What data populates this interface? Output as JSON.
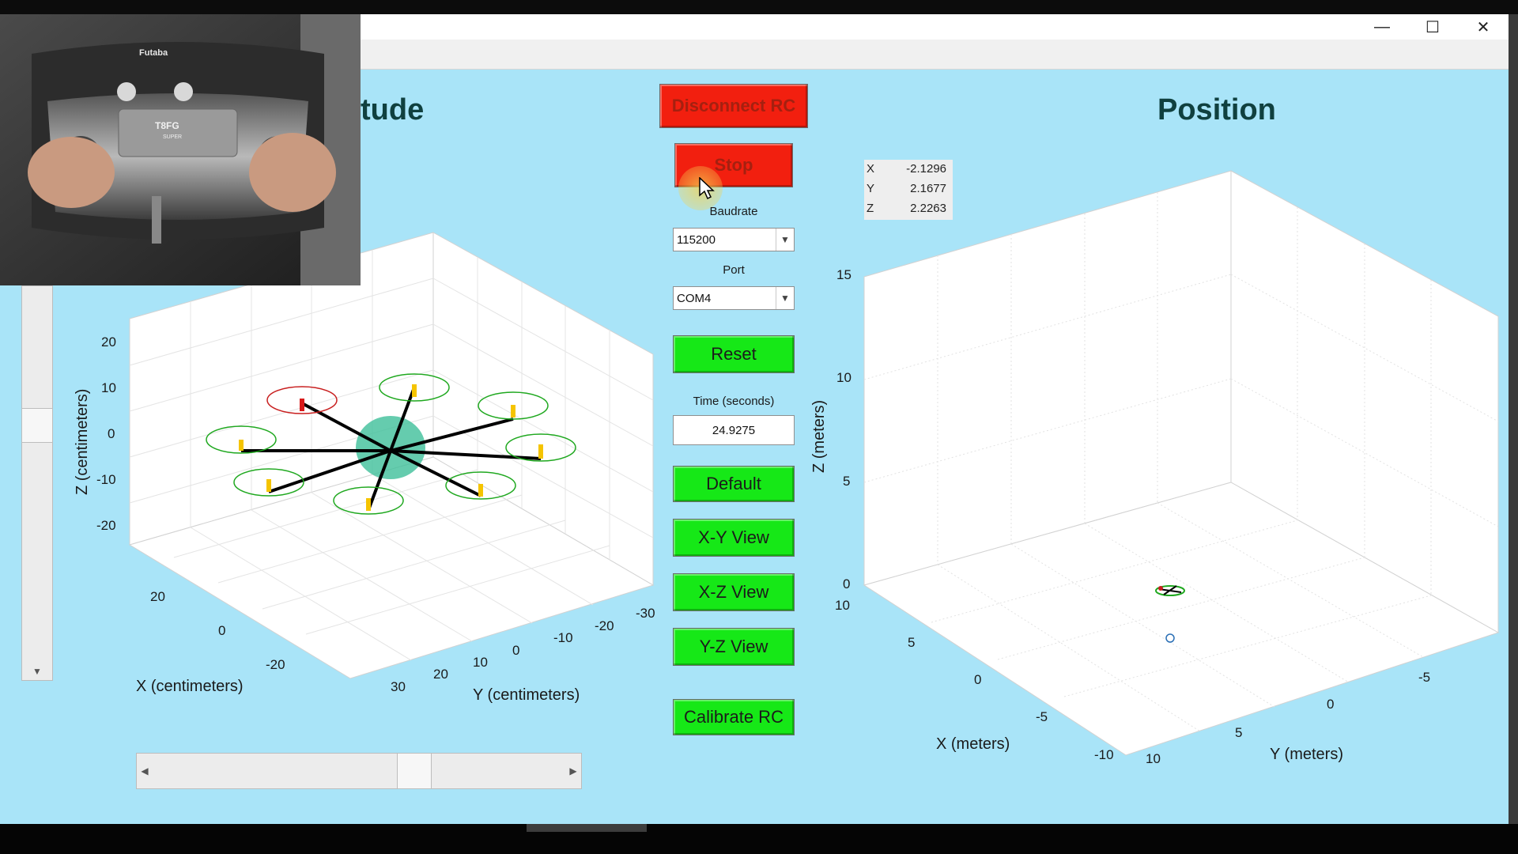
{
  "window": {
    "controls": {
      "minimize": "—",
      "maximize": "☐",
      "close": "✕"
    }
  },
  "webcam": {
    "brand": "Futaba",
    "model": "T8FG",
    "sub": "SUPER"
  },
  "attitude_panel": {
    "title": "tude",
    "x_label": "X (centimeters)",
    "y_label": "Y (centimeters)",
    "z_label": "Z (centimeters)",
    "z_ticks": [
      "20",
      "10",
      "0",
      "-10",
      "-20"
    ],
    "x_ticks": [
      "20",
      "0",
      "-20"
    ],
    "y_ticks": [
      "30",
      "20",
      "10",
      "0",
      "-10",
      "-20",
      "-30"
    ]
  },
  "controls": {
    "disconnect_label": "Disconnect RC",
    "stop_label": "Stop",
    "baudrate_label": "Baudrate",
    "baudrate_value": "115200",
    "port_label": "Port",
    "port_value": "COM4",
    "reset_label": "Reset",
    "time_label": "Time (seconds)",
    "time_value": "24.9275",
    "default_label": "Default",
    "xy_view_label": "X-Y View",
    "xz_view_label": "X-Z View",
    "yz_view_label": "Y-Z View",
    "calibrate_label": "Calibrate RC"
  },
  "position_panel": {
    "title": "Position",
    "readout": [
      {
        "axis": "X",
        "value": "-2.1296"
      },
      {
        "axis": "Y",
        "value": "2.1677"
      },
      {
        "axis": "Z",
        "value": "2.2263"
      }
    ],
    "x_label": "X (meters)",
    "y_label": "Y (meters)",
    "z_label": "Z (meters)",
    "z_ticks": [
      "15",
      "10",
      "5",
      "0"
    ],
    "x_ticks": [
      "10",
      "5",
      "0",
      "-5",
      "-10"
    ],
    "y_ticks": [
      "10",
      "5",
      "0",
      "-5"
    ]
  },
  "colors": {
    "background": "#a9e4f8",
    "red_button": "#f21f0f",
    "green_button": "#16e817",
    "rotor_green": "#1fa81f",
    "rotor_red": "#c81e1e",
    "prop_yellow": "#f5c400",
    "body_teal": "#3fbf9a"
  }
}
